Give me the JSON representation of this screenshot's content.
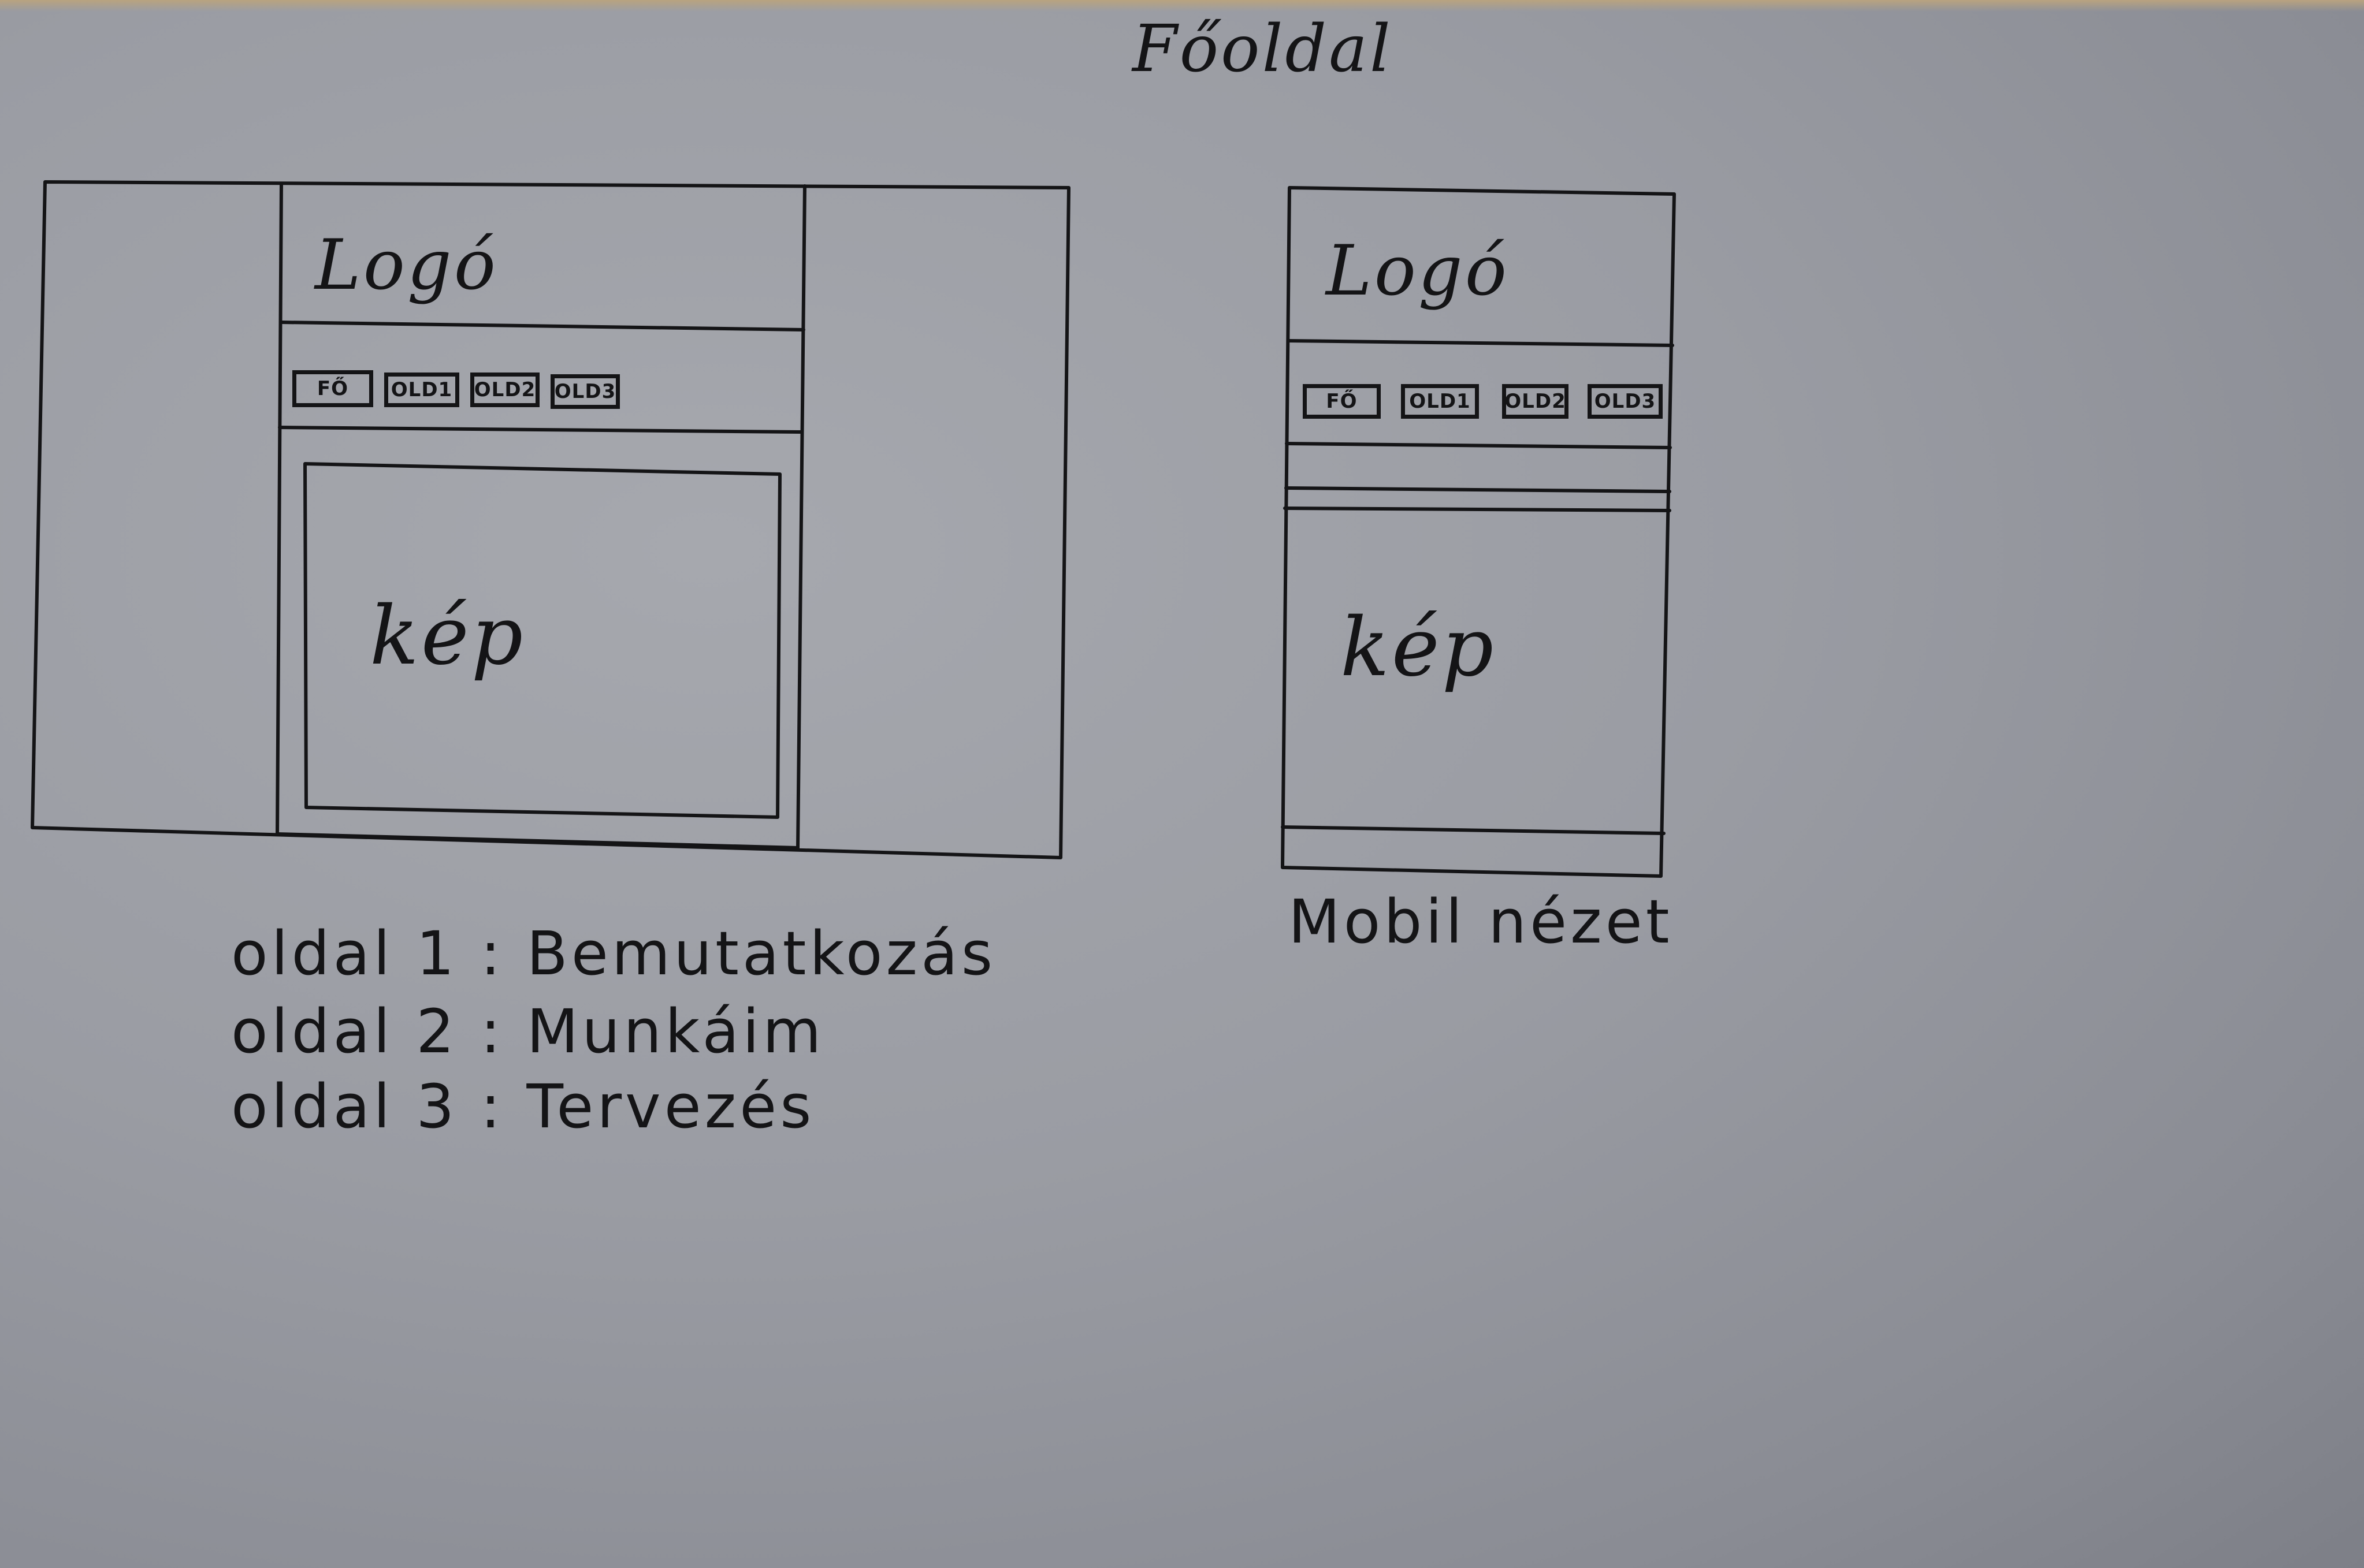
{
  "title": "Főoldal",
  "desktop": {
    "logo": "Logó",
    "nav": [
      "FŐ",
      "OLD1",
      "OLD2",
      "OLD3"
    ],
    "image_label": "kép"
  },
  "mobile": {
    "logo": "Logó",
    "nav": [
      "FŐ",
      "OLD1",
      "OLD2",
      "OLD3"
    ],
    "image_label": "kép",
    "caption": "Mobil nézet"
  },
  "legend": [
    "oldal 1 : Bemutatkozás",
    "oldal 2 : Munkáim",
    "oldal 3 : Tervezés"
  ]
}
